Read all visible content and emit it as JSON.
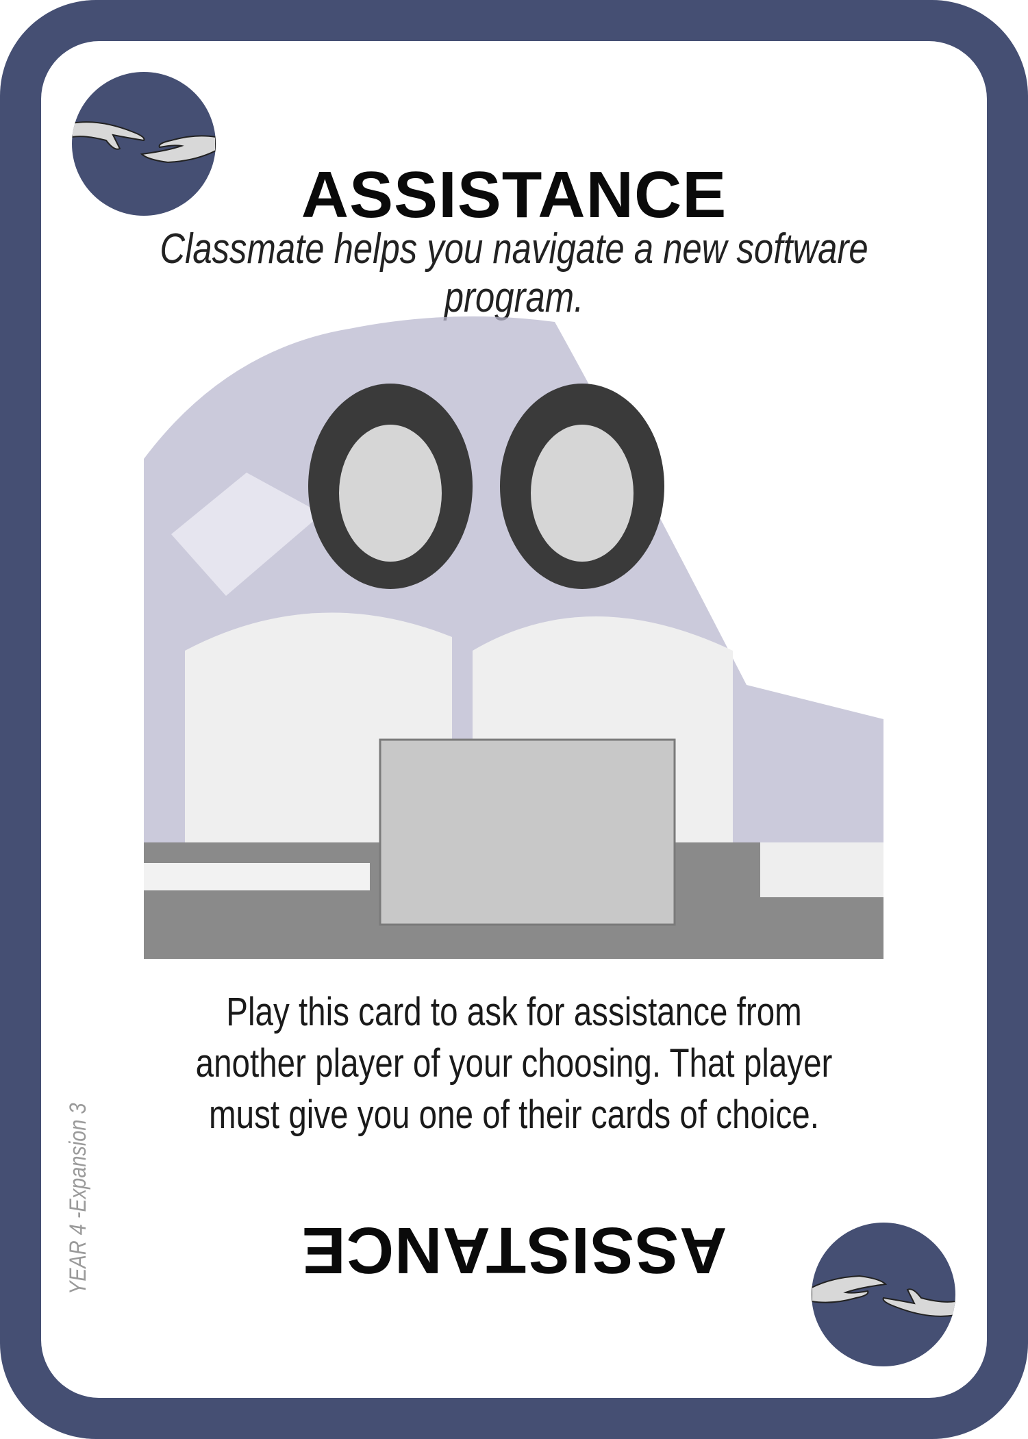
{
  "card": {
    "title": "ASSISTANCE",
    "subtitle": "Classmate helps you navigate a new software program.",
    "body": "Play this card to ask for assistance from another player of your choosing. That player must give you one of their cards of choice.",
    "title_inverted": "ASSISTANCE",
    "edition": "YEAR 4 -Expansion 3",
    "icon": "reaching-hands-icon",
    "image": "two-students-at-laptop-illustration",
    "colors": {
      "border": "#454f73",
      "text": "#0a0a0a",
      "wash": "#b9b8cf"
    }
  }
}
